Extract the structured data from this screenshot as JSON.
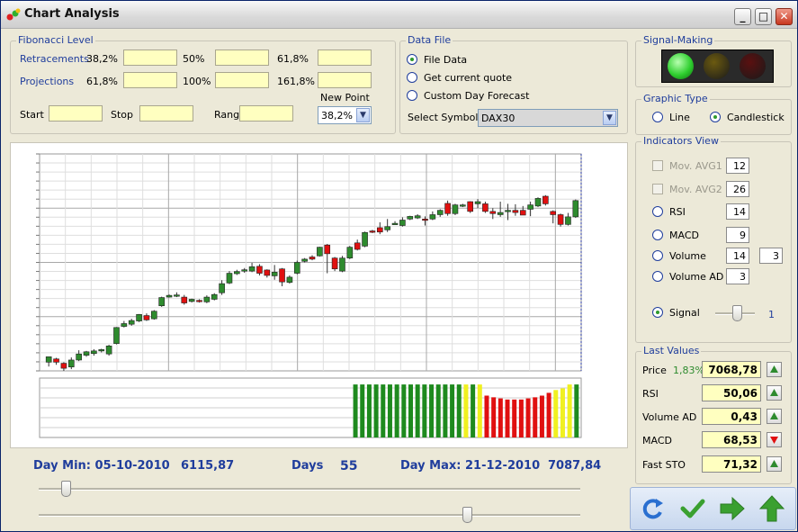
{
  "window": {
    "title": "Chart Analysis"
  },
  "fibonacci": {
    "title": "Fibonacci Level",
    "retracements_label": "Retracements",
    "projections_label": "Projections",
    "retr_levels": [
      "38,2%",
      "50%",
      "61,8%"
    ],
    "proj_levels": [
      "61,8%",
      "100%",
      "161,8%"
    ],
    "start_label": "Start",
    "stop_label": "Stop",
    "range_label": "Range",
    "new_point_label": "New Point",
    "new_point_value": "38,2%"
  },
  "data_file": {
    "title": "Data File",
    "options": [
      "File Data",
      "Get current quote",
      "Custom Day Forecast"
    ],
    "selected": 0,
    "symbol_label": "Select Symbol",
    "symbol_value": "DAX30"
  },
  "signal_making": {
    "title": "Signal-Making",
    "lights": [
      {
        "color": "#2fcf2f",
        "state": "on"
      },
      {
        "color": "#6b5a10",
        "state": "off"
      },
      {
        "color": "#5a1010",
        "state": "off"
      }
    ]
  },
  "graphic_type": {
    "title": "Graphic Type",
    "options": [
      "Line",
      "Candlestick"
    ],
    "selected": 1
  },
  "indicators": {
    "title": "Indicators View",
    "mov_avg1": {
      "label": "Mov. AVG1",
      "value": "12"
    },
    "mov_avg2": {
      "label": "Mov. AVG2",
      "value": "26"
    },
    "rsi": {
      "label": "RSI",
      "value": "14"
    },
    "macd": {
      "label": "MACD",
      "value": "9"
    },
    "volume": {
      "label": "Volume",
      "value": "14",
      "value2": "3"
    },
    "volume_ad": {
      "label": "Volume AD",
      "value": "3"
    },
    "signal": {
      "label": "Signal",
      "value": "1"
    }
  },
  "last_values": {
    "title": "Last Values",
    "price": {
      "label": "Price",
      "change": "1,83%",
      "value": "7068,78",
      "trend": "up"
    },
    "rsi": {
      "label": "RSI",
      "value": "50,06",
      "trend": "up"
    },
    "volume_ad": {
      "label": "Volume AD",
      "value": "0,43",
      "trend": "up"
    },
    "macd": {
      "label": "MACD",
      "value": "68,53",
      "trend": "down"
    },
    "fast_sto": {
      "label": "Fast STO",
      "value": "71,32",
      "trend": "up"
    }
  },
  "stats": {
    "day_min_label": "Day Min: 05-10-2010",
    "day_min_value": "6115,87",
    "days_label": "Days",
    "days_value": "55",
    "day_max_label": "Day Max: 21-12-2010",
    "day_max_value": "7087,84"
  },
  "sliders": {
    "upper_position": 0.05,
    "lower_position": 0.79,
    "signal_position": 0.55
  },
  "colors": {
    "up": "#2e8b2e",
    "down": "#e01010",
    "signal_yellow": "#f0f020",
    "accent_blue": "#1f3d9c"
  },
  "chart_data": {
    "type": "candlestick",
    "ylim": [
      6100,
      7100
    ],
    "candles": [
      [
        6140,
        6165,
        6120,
        6150
      ],
      [
        6155,
        6140,
        6128,
        6160
      ],
      [
        6135,
        6112,
        6100,
        6140
      ],
      [
        6118,
        6150,
        6108,
        6162
      ],
      [
        6150,
        6178,
        6145,
        6195
      ],
      [
        6172,
        6188,
        6165,
        6192
      ],
      [
        6180,
        6192,
        6170,
        6200
      ],
      [
        6192,
        6198,
        6185,
        6202
      ],
      [
        6178,
        6215,
        6170,
        6220
      ],
      [
        6226,
        6300,
        6222,
        6302
      ],
      [
        6305,
        6318,
        6300,
        6330
      ],
      [
        6315,
        6332,
        6308,
        6340
      ],
      [
        6330,
        6360,
        6325,
        6362
      ],
      [
        6355,
        6335,
        6330,
        6365
      ],
      [
        6340,
        6375,
        6336,
        6380
      ],
      [
        6400,
        6438,
        6395,
        6442
      ],
      [
        6440,
        6448,
        6438,
        6452
      ],
      [
        6446,
        6450,
        6440,
        6462
      ],
      [
        6440,
        6413,
        6405,
        6450
      ],
      [
        6420,
        6430,
        6415,
        6433
      ],
      [
        6425,
        6420,
        6415,
        6430
      ],
      [
        6418,
        6440,
        6412,
        6448
      ],
      [
        6430,
        6452,
        6425,
        6458
      ],
      [
        6460,
        6502,
        6450,
        6518
      ],
      [
        6505,
        6550,
        6500,
        6560
      ],
      [
        6548,
        6558,
        6542,
        6566
      ],
      [
        6560,
        6566,
        6552,
        6574
      ],
      [
        6560,
        6580,
        6555,
        6598
      ],
      [
        6582,
        6550,
        6540,
        6592
      ],
      [
        6565,
        6540,
        6530,
        6568
      ],
      [
        6538,
        6555,
        6520,
        6588
      ],
      [
        6570,
        6510,
        6490,
        6574
      ],
      [
        6508,
        6532,
        6502,
        6540
      ],
      [
        6550,
        6600,
        6545,
        6608
      ],
      [
        6605,
        6615,
        6600,
        6620
      ],
      [
        6625,
        6615,
        6610,
        6633
      ],
      [
        6630,
        6670,
        6627,
        6672
      ],
      [
        6680,
        6640,
        6550,
        6685
      ],
      [
        6620,
        6570,
        6560,
        6625
      ],
      [
        6560,
        6620,
        6555,
        6630
      ],
      [
        6620,
        6670,
        6615,
        6676
      ],
      [
        6690,
        6660,
        6655,
        6705
      ],
      [
        6675,
        6738,
        6670,
        6742
      ],
      [
        6745,
        6740,
        6735,
        6750
      ],
      [
        6760,
        6740,
        6730,
        6785
      ],
      [
        6750,
        6765,
        6740,
        6800
      ],
      [
        6780,
        6780,
        6775,
        6790
      ],
      [
        6770,
        6795,
        6765,
        6808
      ],
      [
        6800,
        6812,
        6795,
        6815
      ],
      [
        6805,
        6815,
        6800,
        6822
      ],
      [
        6800,
        6798,
        6770,
        6812
      ],
      [
        6800,
        6820,
        6795,
        6835
      ],
      [
        6820,
        6840,
        6810,
        6845
      ],
      [
        6872,
        6825,
        6815,
        6885
      ],
      [
        6825,
        6865,
        6818,
        6870
      ],
      [
        6862,
        6865,
        6855,
        6870
      ],
      [
        6880,
        6835,
        6828,
        6882
      ],
      [
        6870,
        6880,
        6850,
        6892
      ],
      [
        6870,
        6835,
        6828,
        6880
      ],
      [
        6835,
        6825,
        6800,
        6850
      ],
      [
        6820,
        6830,
        6810,
        6880
      ],
      [
        6840,
        6840,
        6795,
        6870
      ],
      [
        6840,
        6830,
        6815,
        6868
      ],
      [
        6840,
        6818,
        6818,
        6860
      ],
      [
        6845,
        6865,
        6813,
        6880
      ],
      [
        6860,
        6895,
        6855,
        6900
      ],
      [
        6905,
        6870,
        6862,
        6910
      ],
      [
        6835,
        6820,
        6780,
        6840
      ],
      [
        6820,
        6775,
        6765,
        6825
      ],
      [
        6775,
        6810,
        6770,
        6828
      ],
      [
        6810,
        6885,
        6805,
        6890
      ]
    ],
    "signal_bars": [
      {
        "v": 0.95,
        "c": "green"
      },
      {
        "v": 0.95,
        "c": "green"
      },
      {
        "v": 0.95,
        "c": "green"
      },
      {
        "v": 0.95,
        "c": "green"
      },
      {
        "v": 0.95,
        "c": "green"
      },
      {
        "v": 0.95,
        "c": "green"
      },
      {
        "v": 0.95,
        "c": "green"
      },
      {
        "v": 0.95,
        "c": "green"
      },
      {
        "v": 0.95,
        "c": "green"
      },
      {
        "v": 0.95,
        "c": "green"
      },
      {
        "v": 0.95,
        "c": "green"
      },
      {
        "v": 0.95,
        "c": "green"
      },
      {
        "v": 0.95,
        "c": "green"
      },
      {
        "v": 0.95,
        "c": "green"
      },
      {
        "v": 0.95,
        "c": "green"
      },
      {
        "v": 0.95,
        "c": "green"
      },
      {
        "v": 0.95,
        "c": "yellow"
      },
      {
        "v": 0.95,
        "c": "green"
      },
      {
        "v": 0.95,
        "c": "yellow"
      },
      {
        "v": 0.75,
        "c": "red"
      },
      {
        "v": 0.72,
        "c": "red"
      },
      {
        "v": 0.7,
        "c": "red"
      },
      {
        "v": 0.68,
        "c": "red"
      },
      {
        "v": 0.68,
        "c": "red"
      },
      {
        "v": 0.68,
        "c": "red"
      },
      {
        "v": 0.7,
        "c": "red"
      },
      {
        "v": 0.72,
        "c": "red"
      },
      {
        "v": 0.75,
        "c": "red"
      },
      {
        "v": 0.8,
        "c": "red"
      },
      {
        "v": 0.85,
        "c": "yellow"
      },
      {
        "v": 0.88,
        "c": "yellow"
      },
      {
        "v": 0.95,
        "c": "yellow"
      },
      {
        "v": 0.95,
        "c": "green"
      }
    ]
  }
}
